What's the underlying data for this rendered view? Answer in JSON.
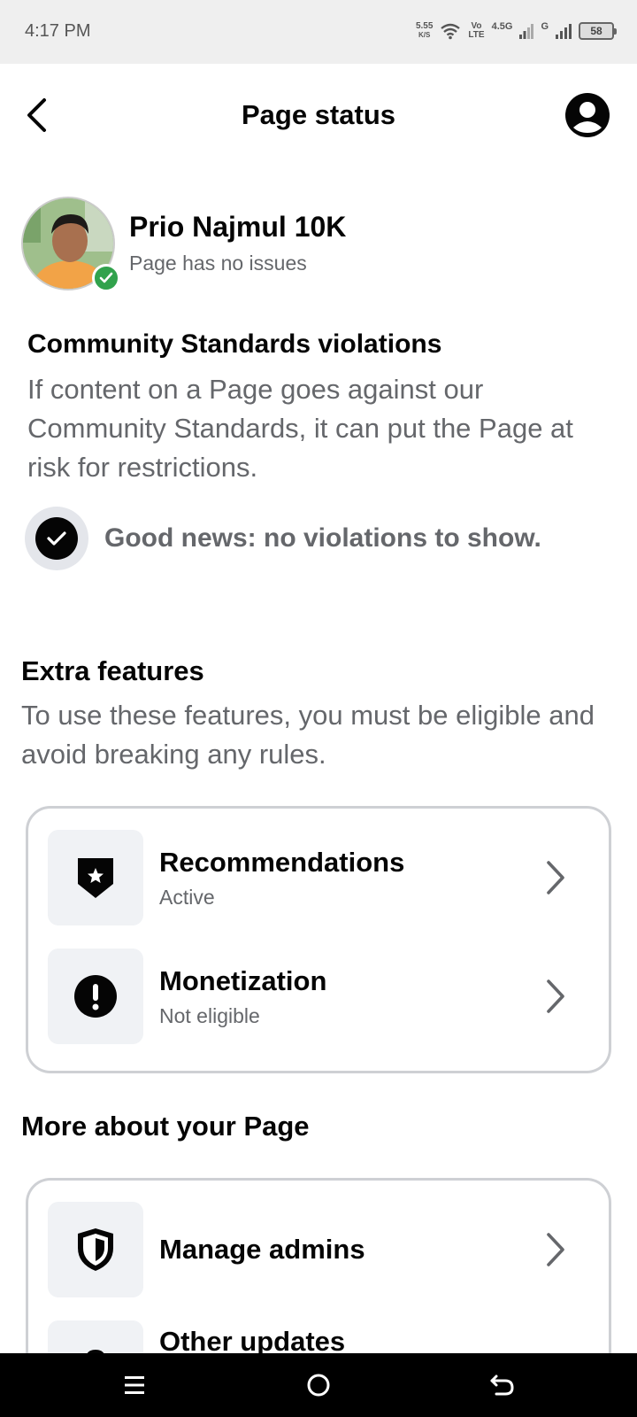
{
  "status_bar": {
    "time": "4:17 PM",
    "speed_value": "5.55",
    "speed_unit": "K/S",
    "volte_top": "Vo",
    "volte_bottom": "LTE",
    "network_1": "4.5G",
    "network_2": "G",
    "battery": "58"
  },
  "header": {
    "title": "Page status",
    "back_icon": "chevron-left-icon",
    "profile_icon": "user-circle-icon"
  },
  "profile": {
    "name": "Prio Najmul 10K",
    "status": "Page has no issues"
  },
  "community": {
    "title": "Community Standards violations",
    "description": "If content on a Page goes against our Community Standards, it can put the Page at risk for restrictions.",
    "good_news": "Good news: no violations to show."
  },
  "extra_features": {
    "title": "Extra features",
    "description": "To use these features, you must be eligible and avoid breaking any rules.",
    "items": [
      {
        "title": "Recommendations",
        "status": "Active",
        "icon": "shield-star-icon"
      },
      {
        "title": "Monetization",
        "status": "Not eligible",
        "icon": "exclamation-circle-icon"
      }
    ]
  },
  "more_about": {
    "title": "More about your Page",
    "items": [
      {
        "title": "Manage admins",
        "icon": "shield-icon"
      },
      {
        "title": "Other updates",
        "icon": "lock-icon"
      }
    ]
  },
  "colors": {
    "text_primary": "#050505",
    "text_secondary": "#65676b",
    "verified_green": "#31a24c",
    "card_border": "#ced0d4",
    "icon_box_bg": "#f0f2f5"
  }
}
